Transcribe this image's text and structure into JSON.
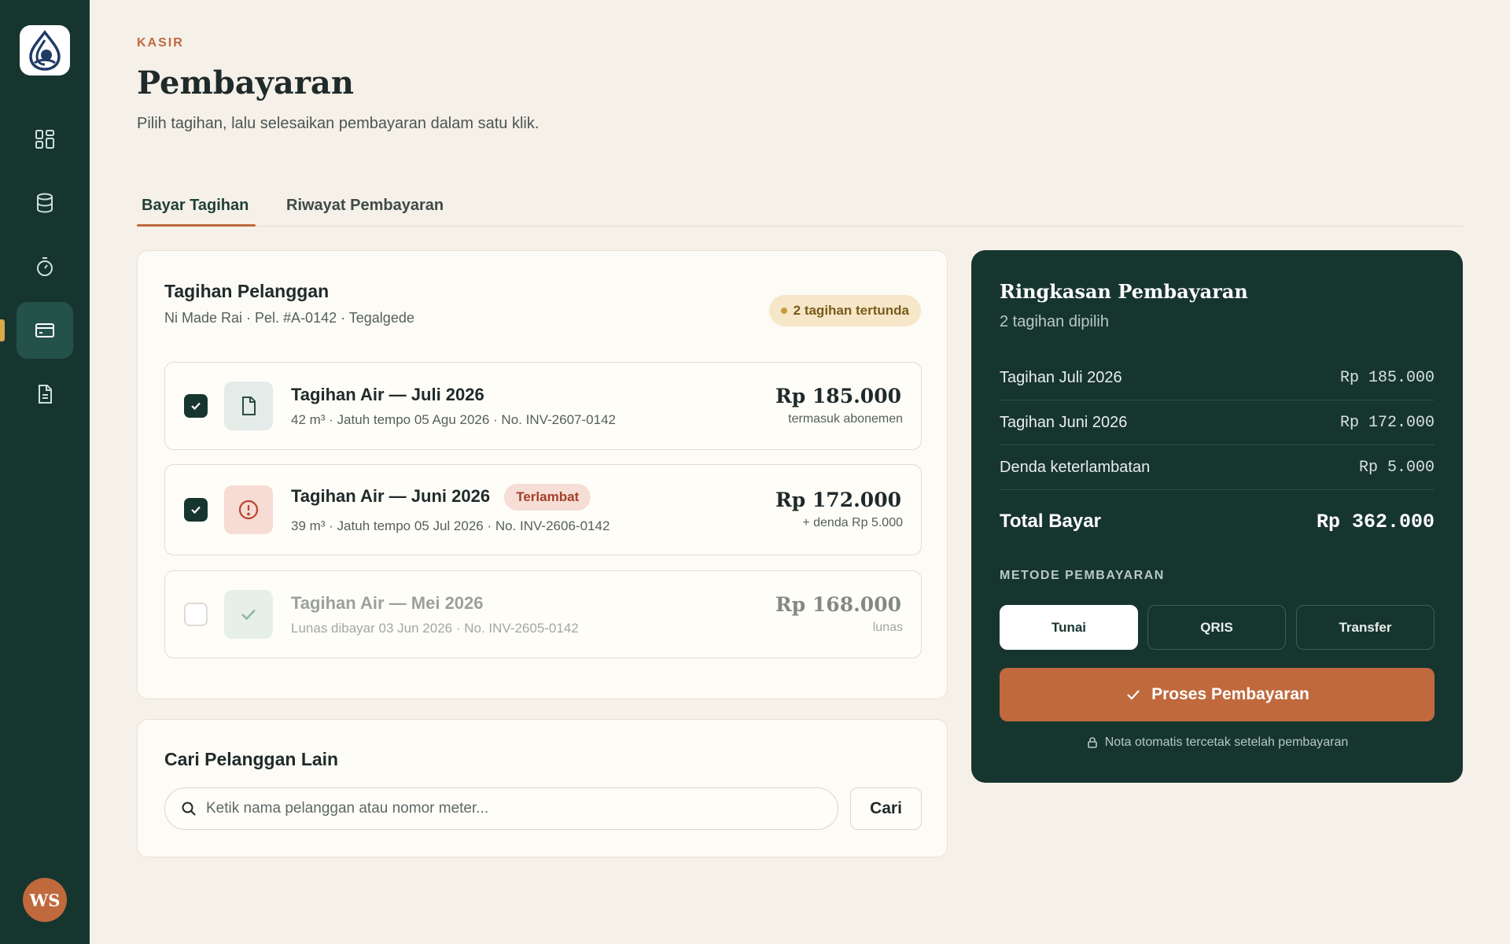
{
  "header": {
    "eyebrow": "KASIR",
    "title": "Pembayaran",
    "subtitle": "Pilih tagihan, lalu selesaikan pembayaran dalam satu klik."
  },
  "tabs": [
    {
      "label": "Bayar Tagihan",
      "active": true
    },
    {
      "label": "Riwayat Pembayaran",
      "active": false
    }
  ],
  "sidebar": {
    "items": [
      {
        "icon": "dashboard-icon"
      },
      {
        "icon": "database-icon"
      },
      {
        "icon": "timer-icon"
      },
      {
        "icon": "credit-card-icon",
        "active": true
      },
      {
        "icon": "document-icon"
      }
    ],
    "avatar_initials": "WS"
  },
  "bills": {
    "title": "Tagihan Pelanggan",
    "customer": "Ni Made Rai · Pel. #A-0142 · Tegalgede",
    "pending_badge": "2 tagihan tertunda",
    "items": [
      {
        "name": "Tagihan Air — Juli 2026",
        "meta": "42 m³ · Jatuh tempo 05 Agu 2026 · No. INV-2607-0142",
        "amount": "Rp 185.000",
        "note": "termasuk abonemen",
        "checked": true,
        "status": ""
      },
      {
        "name": "Tagihan Air — Juni 2026",
        "meta": "39 m³ · Jatuh tempo 05 Jul 2026 · No. INV-2606-0142",
        "amount": "Rp 172.000",
        "note": "+ denda Rp 5.000",
        "checked": true,
        "status": "Terlambat"
      },
      {
        "name": "Tagihan Air — Mei 2026",
        "meta": "Lunas dibayar 03 Jun 2026 · No. INV-2605-0142",
        "amount": "Rp 168.000",
        "note": "lunas",
        "checked": false,
        "status": ""
      }
    ]
  },
  "search": {
    "title": "Cari Pelanggan Lain",
    "placeholder": "Ketik nama pelanggan atau nomor meter...",
    "button": "Cari"
  },
  "summary": {
    "title": "Ringkasan Pembayaran",
    "subtitle": "2 tagihan dipilih",
    "rows": [
      {
        "label": "Tagihan Juli 2026",
        "value": "Rp 185.000"
      },
      {
        "label": "Tagihan Juni 2026",
        "value": "Rp 172.000"
      },
      {
        "label": "Denda keterlambatan",
        "value": "Rp 5.000"
      }
    ],
    "total_label": "Total Bayar",
    "total_value": "Rp 362.000",
    "method_label": "METODE PEMBAYARAN",
    "methods": [
      {
        "label": "Tunai",
        "active": true
      },
      {
        "label": "QRIS",
        "active": false
      },
      {
        "label": "Transfer",
        "active": false
      }
    ],
    "process_button": "Proses Pembayaran",
    "footnote": "Nota otomatis tercetak setelah pembayaran"
  },
  "colors": {
    "sidebar": "#17352f",
    "accent": "#c0693d",
    "background": "#f5f0e8",
    "late": "#a3402a"
  }
}
